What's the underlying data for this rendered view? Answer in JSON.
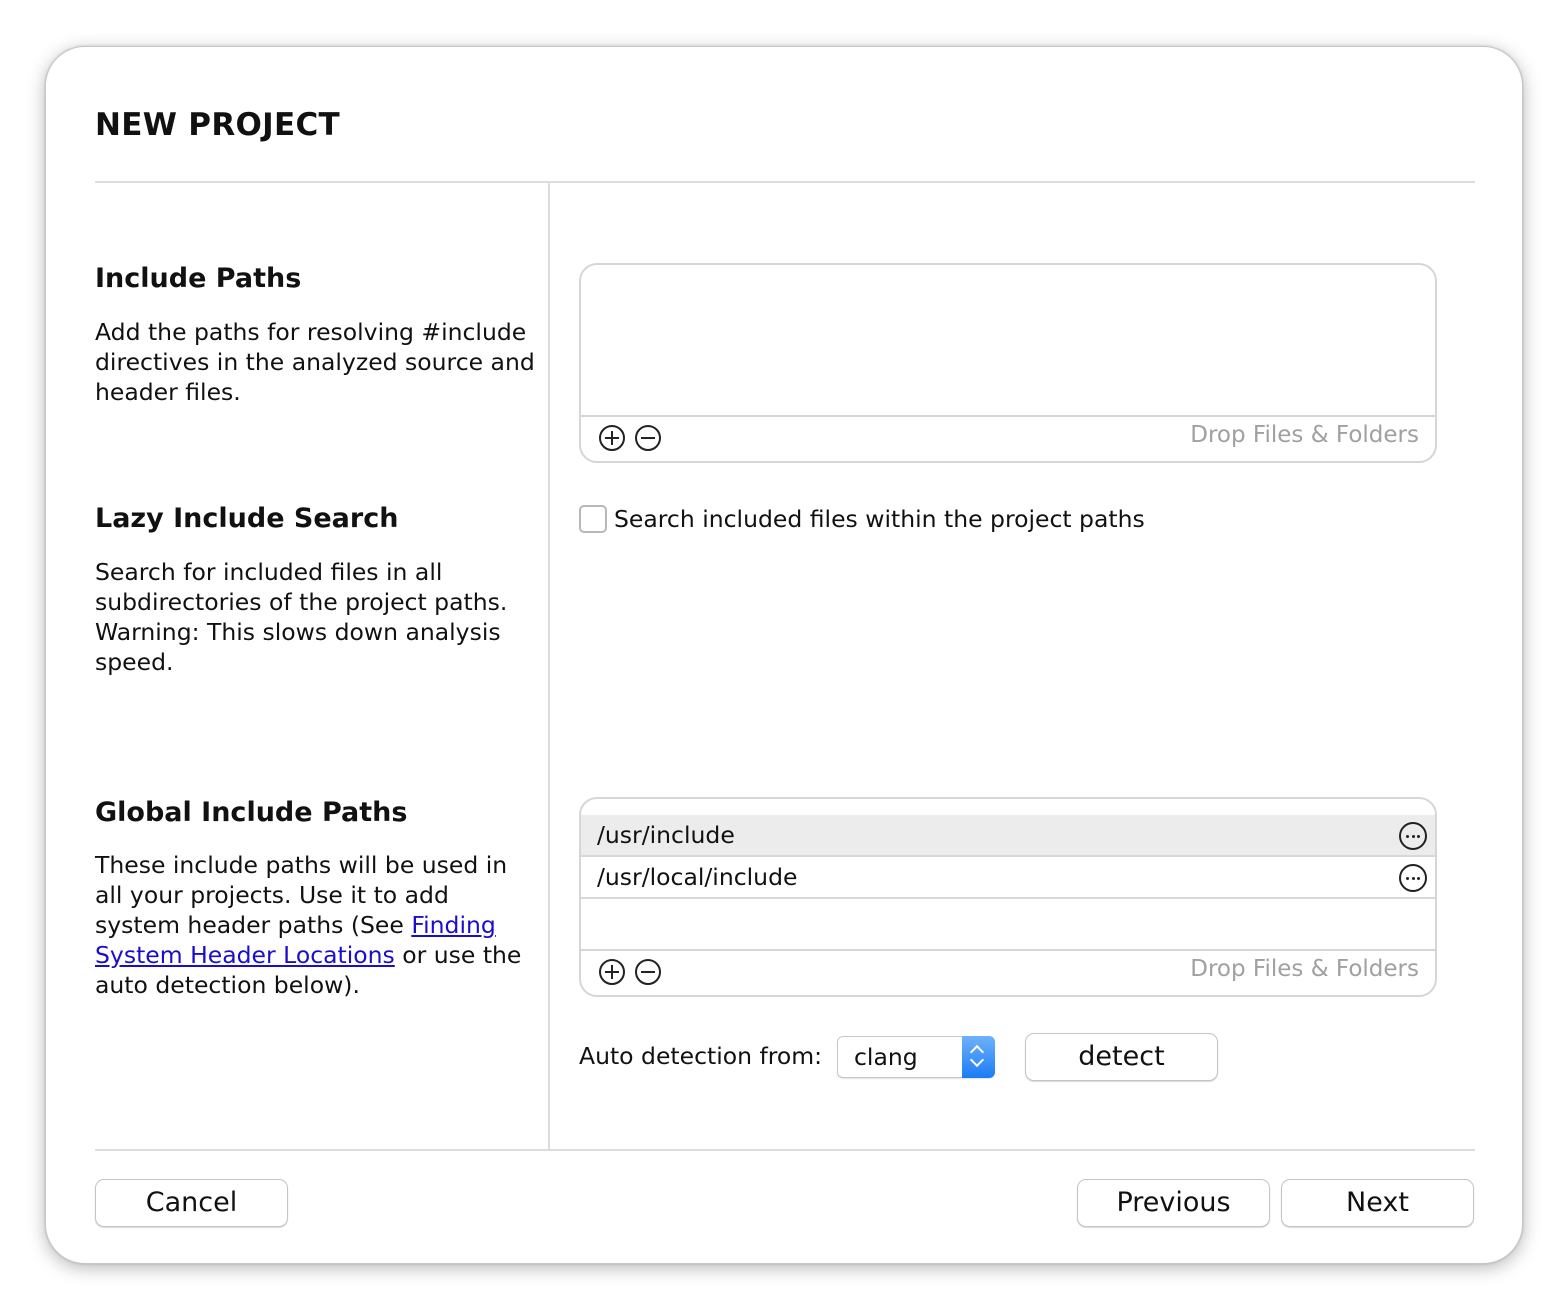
{
  "dialog": {
    "title": "NEW PROJECT"
  },
  "include_paths": {
    "title": "Include Paths",
    "description": "Add the paths for resolving #include directives in the analyzed source and header files.",
    "items": [],
    "drop_hint": "Drop Files & Folders"
  },
  "lazy_search": {
    "title": "Lazy Include Search",
    "description": "Search for included files in all subdirectories of the project paths. Warning: This slows down analysis speed.",
    "checkbox_label": "Search included files within the project paths",
    "checked": false
  },
  "global_paths": {
    "title": "Global Include Paths",
    "description_before": "These include paths will be used in all your projects. Use it to add system header paths (See ",
    "link_text": "Finding System Header Locations",
    "description_after": " or use the auto detection below).",
    "items": [
      "/usr/include",
      "/usr/local/include"
    ],
    "drop_hint": "Drop Files & Folders",
    "auto_detect_label": "Auto detection from:",
    "compiler_selected": "clang",
    "detect_button": "detect"
  },
  "footer": {
    "cancel": "Cancel",
    "previous": "Previous",
    "next": "Next"
  },
  "colors": {
    "accent": "#1b7cf5",
    "link": "#1a0dcc",
    "hint": "#a0a0a0"
  }
}
